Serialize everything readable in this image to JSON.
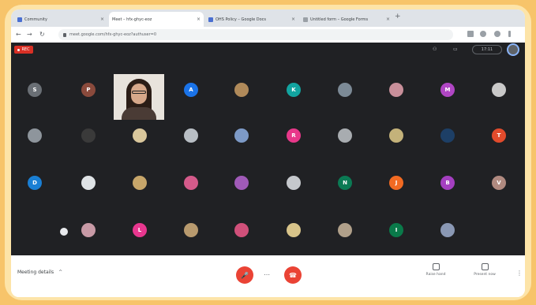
{
  "browser": {
    "tabs": [
      {
        "title": "Community",
        "favicon": "blue",
        "active": false
      },
      {
        "title": "Meet – hfx-ghyc-eoz",
        "favicon": "meet",
        "active": true
      },
      {
        "title": "OHS Policy – Google Docs",
        "favicon": "blue",
        "active": false
      },
      {
        "title": "Untitled form – Google Forms",
        "favicon": "grey",
        "active": false
      }
    ],
    "new_tab_symbol": "+",
    "close_symbol": "×",
    "address": "meet.google.com/hfx-ghyc-eoz?authuser=0",
    "nav": {
      "back": "←",
      "forward": "→",
      "reload": "↻"
    }
  },
  "meet": {
    "recording_label": "REC",
    "layout_pill": "17:11",
    "participants": [
      {
        "color": "#6a6f75",
        "letter": "S"
      },
      {
        "color": "#8a4a3c",
        "letter": "P"
      },
      {
        "color": "#1a73e8",
        "letter": "A"
      },
      {
        "color": "#b08a5a",
        "letter": ""
      },
      {
        "color": "#12a4a0",
        "letter": "K"
      },
      {
        "color": "#7c8a96",
        "letter": ""
      },
      {
        "color": "#c88f9a",
        "letter": ""
      },
      {
        "color": "#b046c4",
        "letter": "M"
      },
      {
        "color": "#c9c9c9",
        "letter": ""
      },
      {
        "color": "#8e959c",
        "letter": ""
      },
      {
        "color": "#3a3a3a",
        "letter": ""
      },
      {
        "color": "#d9c79c",
        "letter": ""
      },
      {
        "color": "#b8bec4",
        "letter": ""
      },
      {
        "color": "#7d9ac7",
        "letter": ""
      },
      {
        "color": "#e8388a",
        "letter": "R"
      },
      {
        "color": "#a8acb0",
        "letter": ""
      },
      {
        "color": "#c4b27a",
        "letter": ""
      },
      {
        "color": "#1d3f66",
        "letter": ""
      },
      {
        "color": "#e24b2c",
        "letter": "T"
      },
      {
        "color": "#1a7fd4",
        "letter": "D"
      },
      {
        "color": "#dfe3e6",
        "letter": ""
      },
      {
        "color": "#c7a66a",
        "letter": ""
      },
      {
        "color": "#d45a8a",
        "letter": ""
      },
      {
        "color": "#a05ab8",
        "letter": ""
      },
      {
        "color": "#c5c8cc",
        "letter": ""
      },
      {
        "color": "#0b7a54",
        "letter": "N"
      },
      {
        "color": "#f26a22",
        "letter": "J"
      },
      {
        "color": "#a43fc0",
        "letter": "B"
      },
      {
        "color": "#b08a80",
        "letter": "V"
      },
      {
        "color": "#c89aa6",
        "letter": ""
      },
      {
        "color": "#e8378f",
        "letter": "L"
      },
      {
        "color": "#b89a6e",
        "letter": ""
      },
      {
        "color": "#d0507a",
        "letter": ""
      },
      {
        "color": "#d8c48a",
        "letter": ""
      },
      {
        "color": "#b0a08a",
        "letter": ""
      },
      {
        "color": "#0a7a4a",
        "letter": "I"
      },
      {
        "color": "#8a98b4",
        "letter": ""
      }
    ]
  },
  "bottom": {
    "meeting_label": "Meeting details",
    "meeting_chevron": "^",
    "mic_symbol": "🎤",
    "end_symbol": "☎",
    "more_symbol": "⋯",
    "raise_hand_label": "Raise hand",
    "present_label": "Present now",
    "kebab": "⋮"
  }
}
